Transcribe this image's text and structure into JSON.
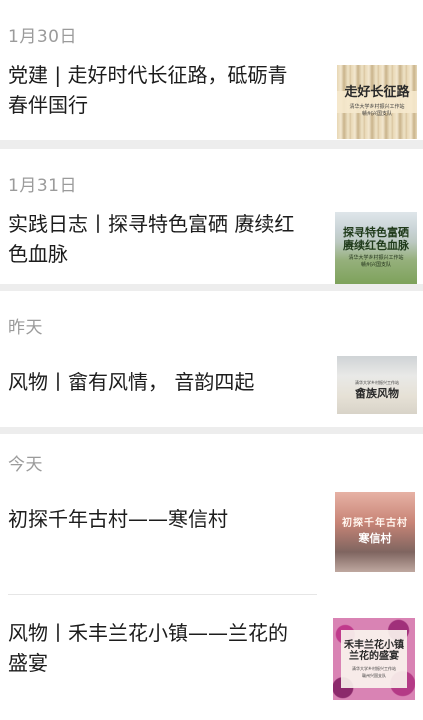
{
  "groups": [
    {
      "date": "1月30日",
      "articles": [
        {
          "title_line1": "党建 | 走好时代长征路，砥砺青",
          "title_line2": "春伴国行",
          "thumb": {
            "headline": "走好长征路",
            "sub1": "清华大学乡村振兴工作站",
            "sub2": "赣州兴国支队"
          }
        }
      ]
    },
    {
      "date": "1月31日",
      "articles": [
        {
          "title_line1": "实践日志丨探寻特色富硒 赓续红",
          "title_line2": "色血脉",
          "thumb": {
            "headline1": "探寻特色富硒",
            "headline2": "赓续红色血脉",
            "sub1": "清华大学乡村振兴工作站",
            "sub2": "赣州兴国支队"
          }
        }
      ]
    },
    {
      "date": "昨天",
      "articles": [
        {
          "title_line1": "风物丨畲有风情， 音韵四起",
          "thumb": {
            "sub1": "清华大学乡村振兴工作站",
            "headline": "畲族风物"
          }
        }
      ]
    },
    {
      "date": "今天",
      "articles": [
        {
          "title_line1": "初探千年古村——寒信村",
          "thumb": {
            "headline1": "初探千年古村",
            "headline2": "寒信村"
          }
        },
        {
          "title_line1": "风物丨禾丰兰花小镇——兰花的",
          "title_line2": "盛宴",
          "thumb": {
            "headline1": "禾丰兰花小镇",
            "headline2": "兰花的盛宴",
            "sub1": "清华大学乡村振兴工作站",
            "sub2": "赣州兴国支队"
          }
        }
      ]
    }
  ]
}
